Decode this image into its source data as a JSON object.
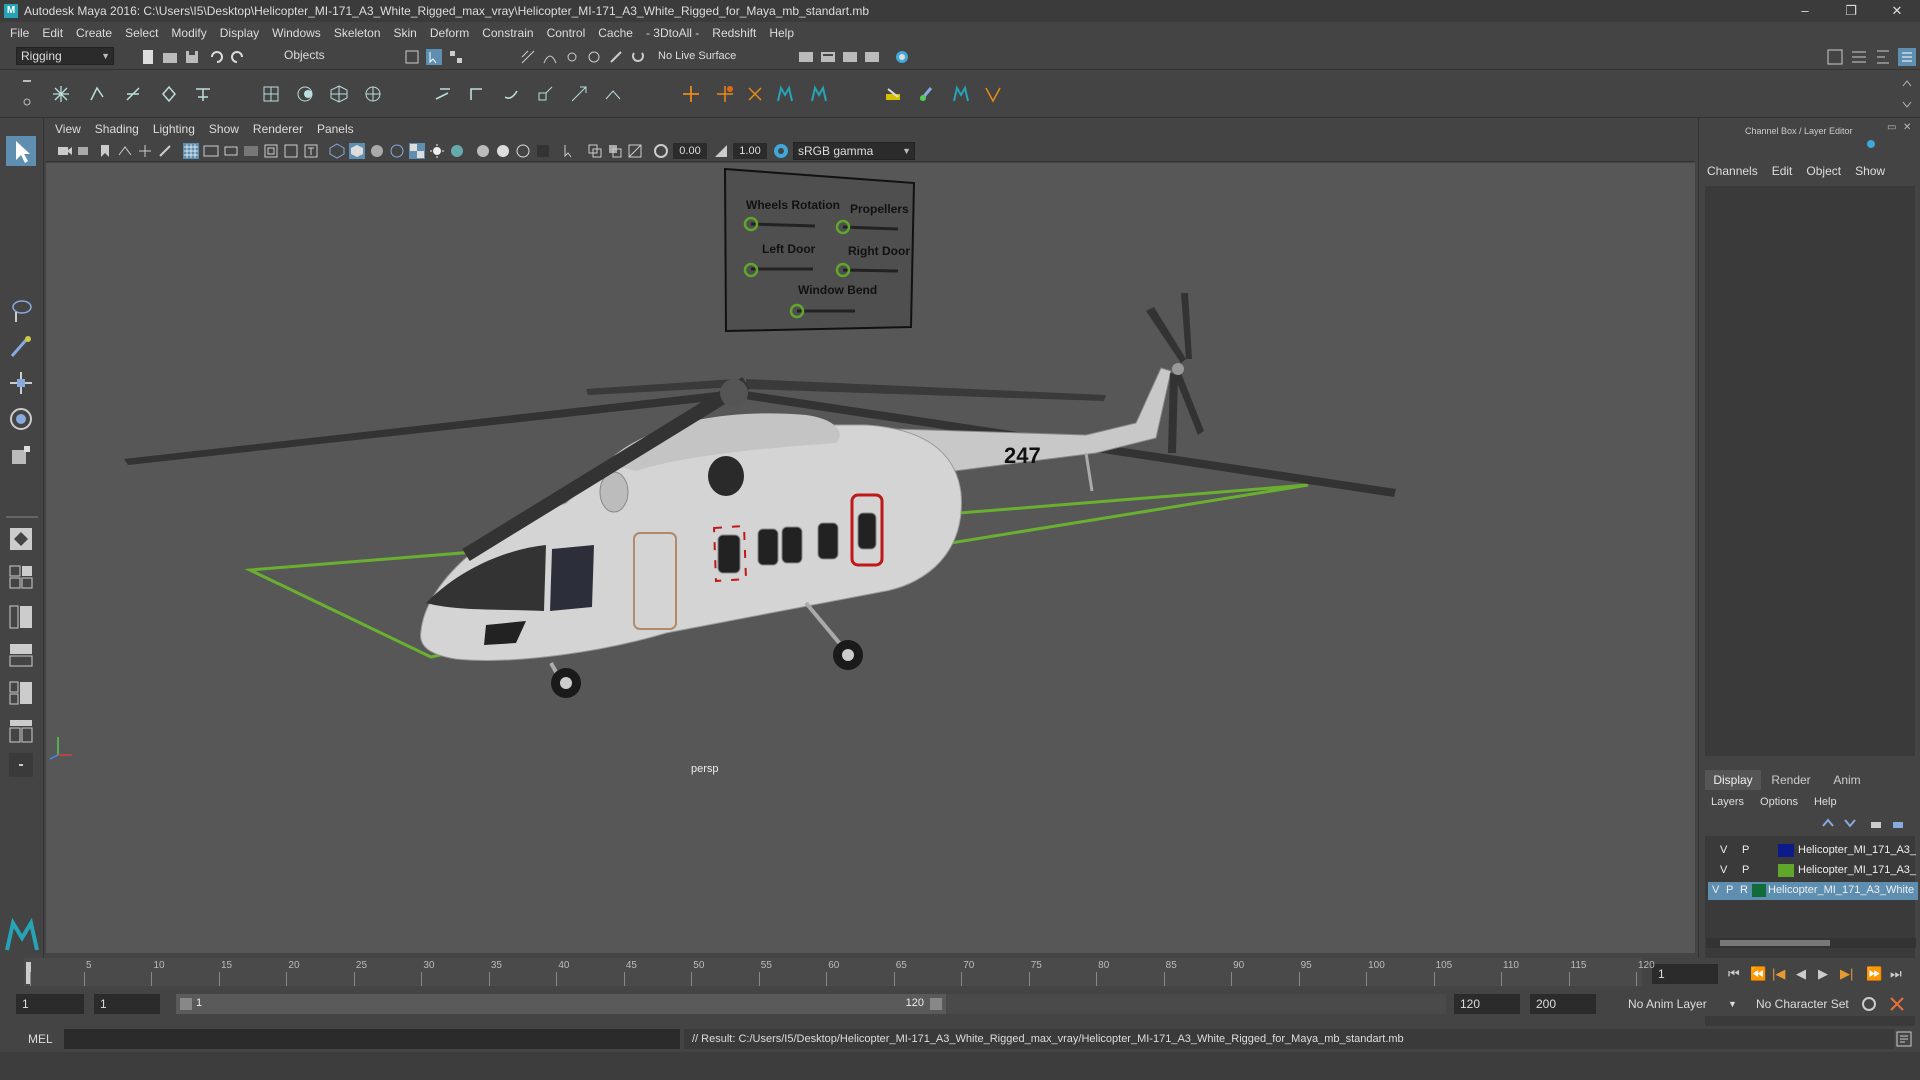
{
  "window": {
    "title": "Autodesk Maya 2016: C:\\Users\\I5\\Desktop\\Helicopter_MI-171_A3_White_Rigged_max_vray\\Helicopter_MI-171_A3_White_Rigged_for_Maya_mb_standart.mb",
    "controls": [
      "–",
      "❐",
      "✕"
    ]
  },
  "menubar": [
    "File",
    "Edit",
    "Create",
    "Select",
    "Modify",
    "Display",
    "Windows",
    "Skeleton",
    "Skin",
    "Deform",
    "Constrain",
    "Control",
    "Cache",
    "- 3DtoAll -",
    "Redshift",
    "Help"
  ],
  "statusline": {
    "mode": "Rigging",
    "selection_mask": "Objects",
    "live_surface": "No Live Surface"
  },
  "panel": {
    "menus": [
      "View",
      "Shading",
      "Lighting",
      "Show",
      "Renderer",
      "Panels"
    ],
    "exposure": "0.00",
    "gamma": "1.00",
    "color_space": "sRGB gamma"
  },
  "viewport": {
    "camera_label": "persp",
    "tail_number": "247",
    "rig_panel": {
      "labels": [
        "Wheels Rotation",
        "Propellers",
        "Left Door",
        "Right Door",
        "Window Bend"
      ]
    }
  },
  "channel_box": {
    "title": "Channel Box / Layer Editor",
    "menus": [
      "Channels",
      "Edit",
      "Object",
      "Show"
    ]
  },
  "layer_editor": {
    "tabs": [
      "Display",
      "Render",
      "Anim"
    ],
    "active_tab": "Display",
    "menus": [
      "Layers",
      "Options",
      "Help"
    ],
    "layers": [
      {
        "v": "V",
        "p": "P",
        "r": "",
        "name": "Helicopter_MI_171_A3_",
        "color": "#0d1a8a",
        "selected": false
      },
      {
        "v": "V",
        "p": "P",
        "r": "",
        "name": "Helicopter_MI_171_A3_",
        "color": "#5fa62a",
        "selected": false
      },
      {
        "v": "V",
        "p": "P",
        "r": "R",
        "name": "Helicopter_MI_171_A3_White",
        "color": "#136b3a",
        "selected": true
      }
    ]
  },
  "timeline": {
    "ticks": [
      "1",
      "5",
      "10",
      "15",
      "20",
      "25",
      "30",
      "35",
      "40",
      "45",
      "50",
      "55",
      "60",
      "65",
      "70",
      "75",
      "80",
      "85",
      "90",
      "95",
      "100",
      "105",
      "110",
      "115",
      "120"
    ],
    "current_frame": "1"
  },
  "range": {
    "start": "1",
    "playback_start": "1",
    "slider_start": "1",
    "slider_end": "120",
    "playback_end": "120",
    "end": "200",
    "anim_layer": "No Anim Layer",
    "character_set": "No Character Set"
  },
  "command": {
    "language": "MEL",
    "result": "// Result: C:/Users/I5/Desktop/Helicopter_MI-171_A3_White_Rigged_max_vray/Helicopter_MI-171_A3_White_Rigged_for_Maya_mb_standart.mb"
  },
  "colors": {
    "accent": "#27a3b6",
    "selection_green": "#6ab030",
    "rig_handle": "#5fa62a",
    "door_highlight": "#c01818"
  }
}
